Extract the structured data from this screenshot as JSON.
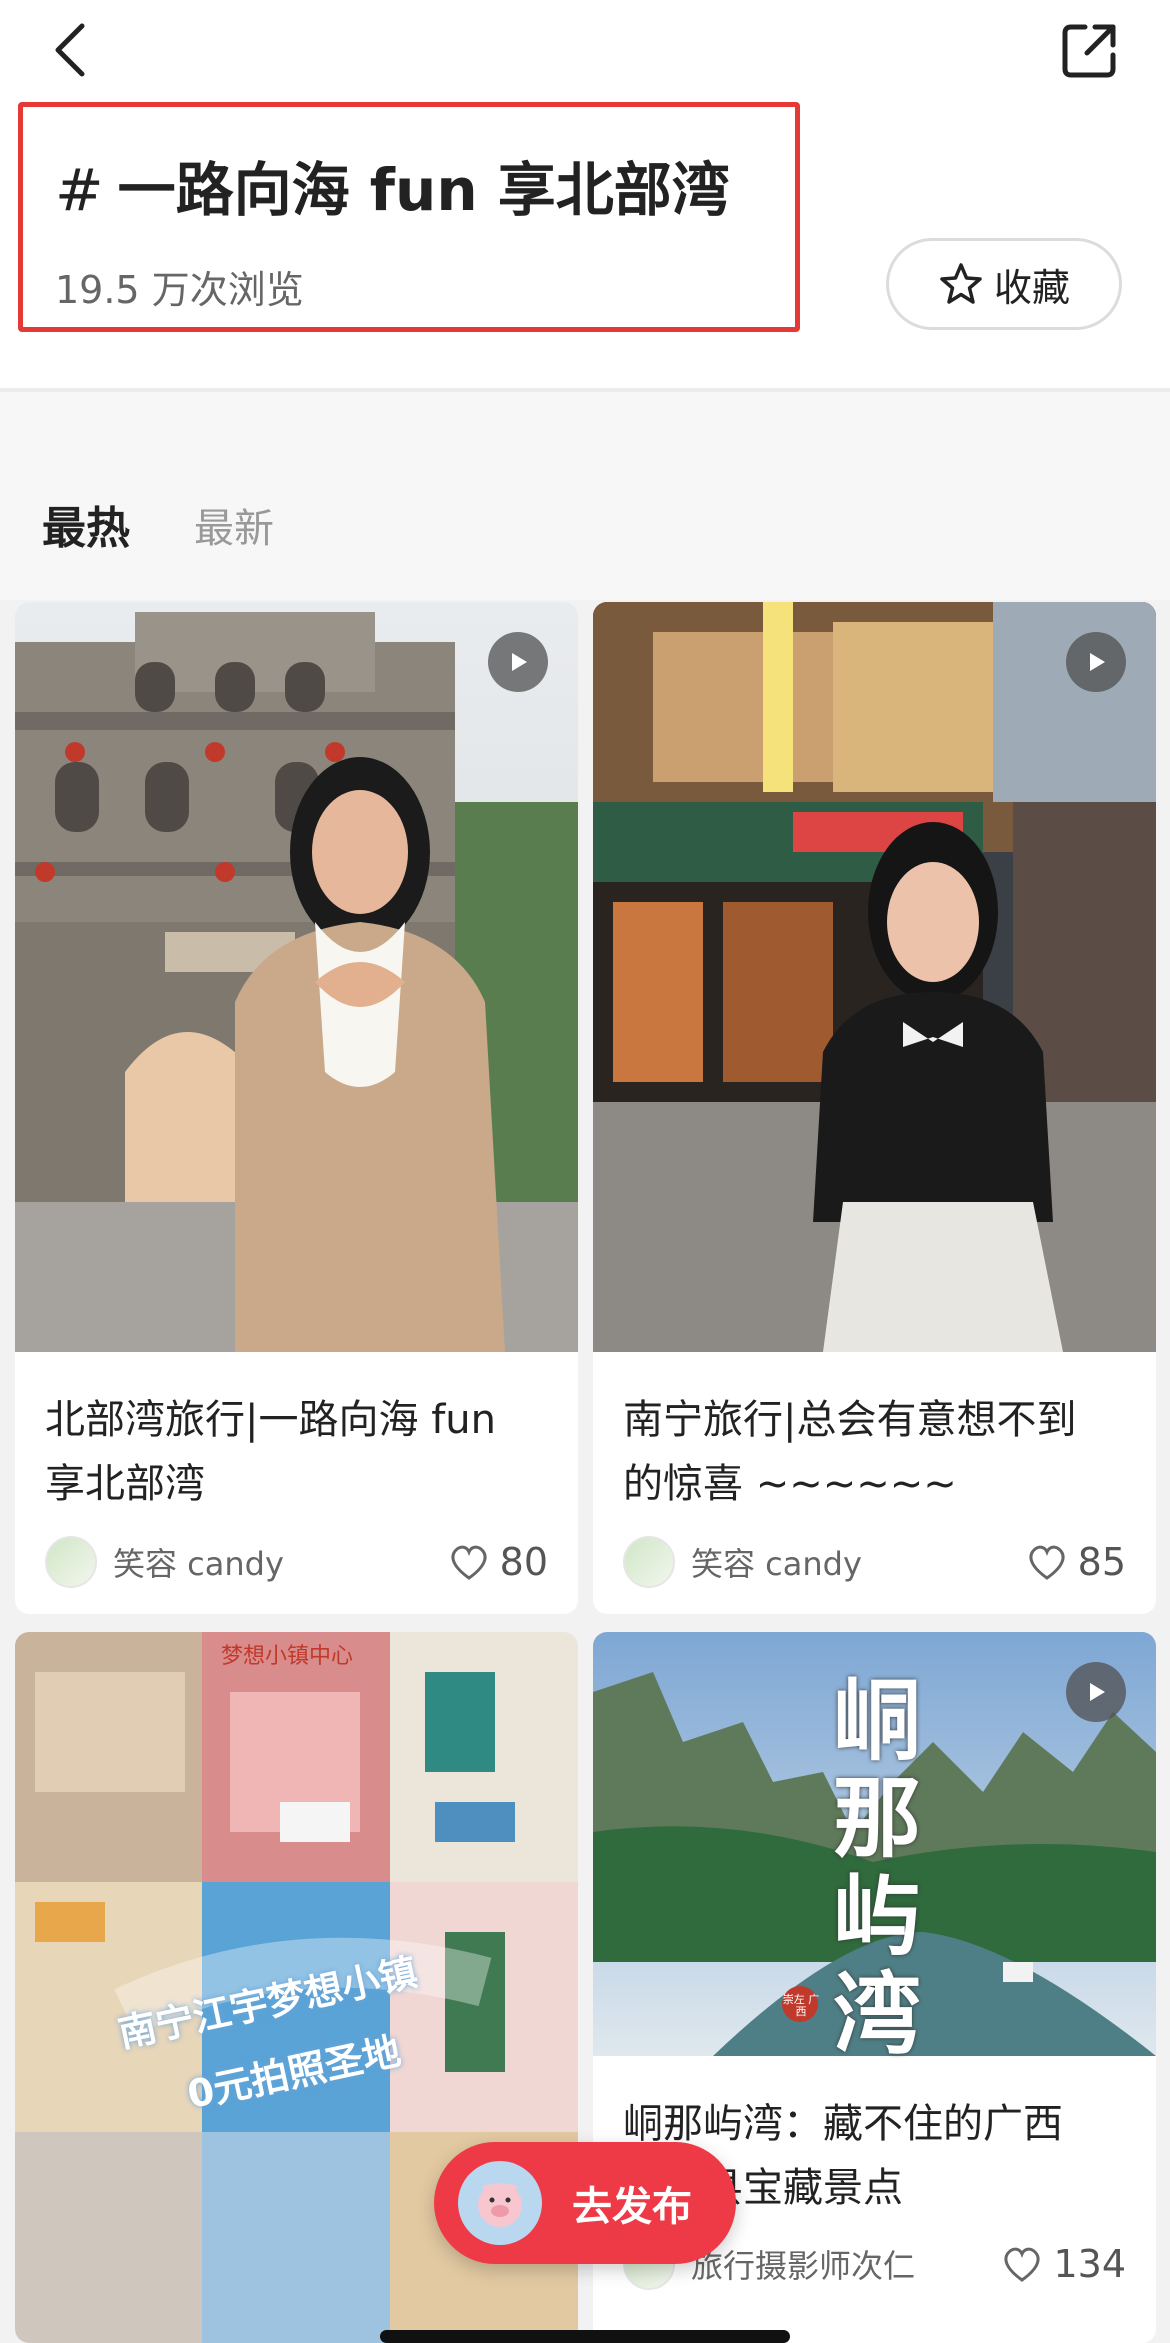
{
  "header": {
    "back_icon": "chevron-left-icon",
    "share_icon": "share-icon"
  },
  "topic": {
    "hash": "#",
    "title": "一路向海 fun 享北部湾",
    "views": "19.5 万次浏览",
    "favorite_label": "收藏",
    "favorite_icon": "star-icon"
  },
  "tabs": [
    {
      "label": "最热",
      "active": true
    },
    {
      "label": "最新",
      "active": false
    }
  ],
  "cards": [
    {
      "title": "北部湾旅行|一路向海 fun\n享北部湾",
      "author": "笑容 candy",
      "likes": "80",
      "has_video": true
    },
    {
      "title": "南宁旅行|总会有意想不到\n的惊喜 ~~~~~~",
      "author": "笑容 candy",
      "likes": "85",
      "has_video": true
    },
    {
      "overlay_text": [
        "南宁江宇梦想小镇",
        "0元拍照圣地"
      ],
      "sign_text": "梦想小镇中心",
      "has_video": false
    },
    {
      "overlay_text": "峒那屿湾",
      "stamp_text": "崇左 广西",
      "title": "峒那屿湾：藏不住的广西\n大新县宝藏景点",
      "author": "旅行摄影师次仁",
      "likes": "134",
      "has_video": true
    }
  ],
  "publish": {
    "label": "去发布"
  },
  "colors": {
    "accent": "#ee3a47",
    "highlight_border": "#e53935"
  }
}
